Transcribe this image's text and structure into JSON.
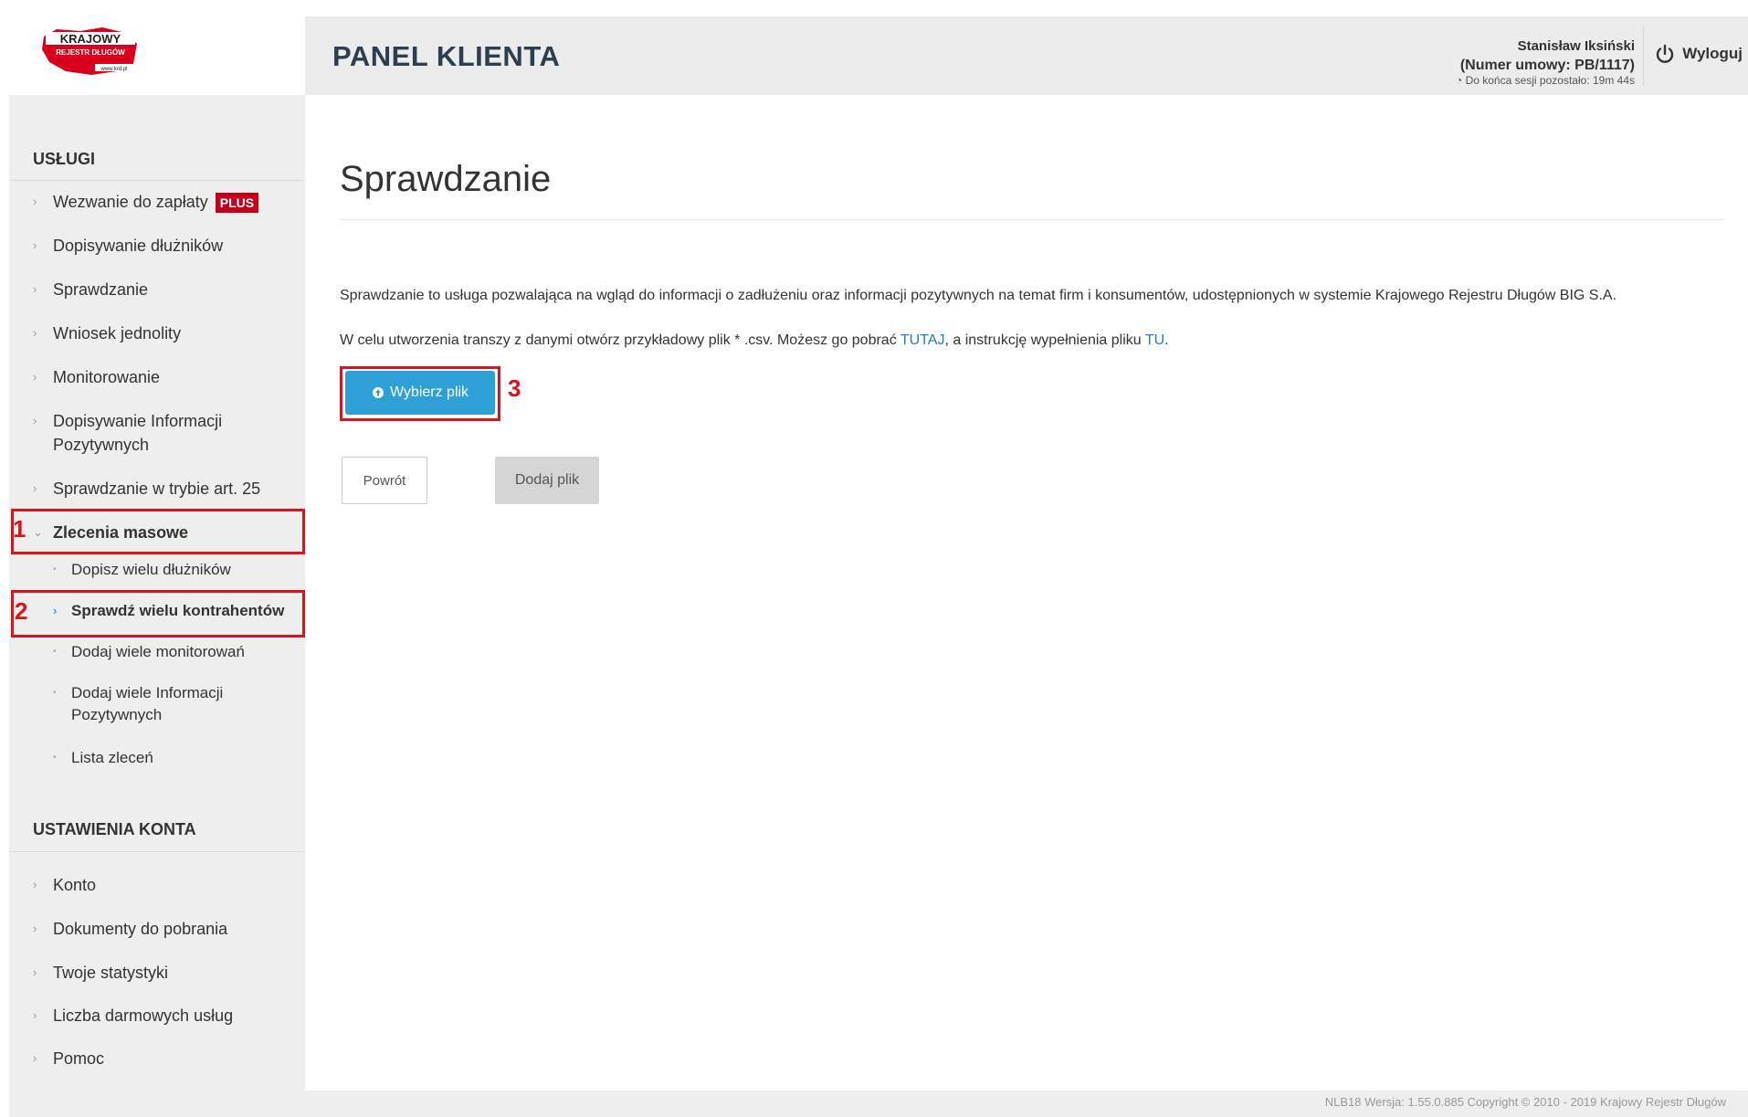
{
  "header": {
    "logo_line1": "KRAJOWY",
    "logo_line2": "REJESTR DŁUGÓW",
    "logo_line3": "www.krd.pl",
    "panel_title": "PANEL KLIENTA",
    "user_name": "Stanisław Iksiński",
    "contract": "(Numer umowy: PB/1117)",
    "session": "Do końca sesji pozostało: 19m 44s",
    "logout_label": "Wyloguj"
  },
  "sidebar": {
    "services_header": "USŁUGI",
    "items": [
      {
        "label": "Wezwanie do zapłaty",
        "badge": "PLUS"
      },
      {
        "label": "Dopisywanie dłużników"
      },
      {
        "label": "Sprawdzanie"
      },
      {
        "label": "Wniosek jednolity"
      },
      {
        "label": "Monitorowanie"
      },
      {
        "label": "Dopisywanie Informacji Pozytywnych"
      },
      {
        "label": "Sprawdzanie w trybie art. 25"
      },
      {
        "label": "Zlecenia masowe"
      }
    ],
    "sub_items": [
      {
        "label": "Dopisz wielu dłużników"
      },
      {
        "label": "Sprawdź wielu kontrahentów"
      },
      {
        "label": "Dodaj wiele monitorowań"
      },
      {
        "label": "Dodaj wiele Informacji Pozytywnych"
      },
      {
        "label": "Lista zleceń"
      }
    ],
    "account_header": "USTAWIENIA KONTA",
    "account_items": [
      {
        "label": "Konto"
      },
      {
        "label": "Dokumenty do pobrania"
      },
      {
        "label": "Twoje statystyki"
      },
      {
        "label": "Liczba darmowych usług"
      },
      {
        "label": "Pomoc"
      }
    ]
  },
  "annotations": {
    "n1": "1",
    "n2": "2",
    "n3": "3"
  },
  "main": {
    "title": "Sprawdzanie",
    "description1": "Sprawdzanie to usługa pozwalająca na wgląd do informacji o zadłużeniu oraz informacji pozytywnych na temat firm i konsumentów, udostępnionych w systemie Krajowego Rejestru Długów BIG S.A.",
    "description2_pre": "W celu utworzenia transzy z danymi otwórz przykładowy plik * .csv. Możesz go pobrać ",
    "link1": "TUTAJ",
    "description2_mid": ", a instrukcję wypełnienia pliku ",
    "link2": "TU",
    "description2_post": ".",
    "choose_file_label": "Wybierz plik",
    "back_label": "Powrót",
    "add_file_label": "Dodaj plik"
  },
  "footer": {
    "text": "NLB18   Wersja: 1.55.0.885   Copyright © 2010 - 2019 Krajowy Rejestr Długów"
  },
  "colors": {
    "accent_blue": "#2ea0d6",
    "annotation_red": "#d9141e",
    "badge_red": "#c4001a",
    "title_dark": "#2d3e50"
  }
}
